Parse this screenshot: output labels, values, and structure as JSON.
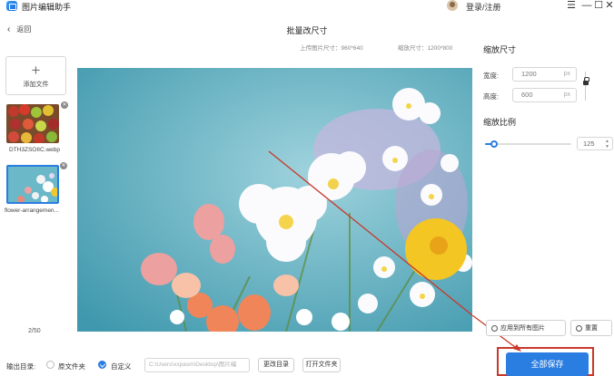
{
  "app": {
    "title": "图片编辑助手",
    "login": "登录/注册"
  },
  "window_controls": [
    "☰",
    "—",
    "☐",
    "✕"
  ],
  "nav": {
    "back": "返回",
    "page_title": "批量改尺寸"
  },
  "info": {
    "upload_size_label": "上传图片尺寸：960*640",
    "scaled_size_label": "缩放尺寸：1200*800"
  },
  "sidebar": {
    "add_file": "添加文件",
    "files": [
      {
        "name": "DTH3ZSOIIC.webp",
        "selected": false
      },
      {
        "name": "flower-arrangemen...",
        "selected": true
      }
    ],
    "page_count": "2/50"
  },
  "resize": {
    "title": "缩放尺寸",
    "width_label": "宽度:",
    "width_value": "1200",
    "height_label": "高度:",
    "height_value": "600",
    "unit": "px"
  },
  "scale": {
    "title": "缩放比例",
    "value": "125",
    "slider_fraction": 0.1
  },
  "actions": {
    "apply_all": "应用到所有图片",
    "reset": "重置"
  },
  "output": {
    "label": "输出目录:",
    "option_original": "原文件夹",
    "option_custom": "自定义",
    "selected": "custom",
    "path": "C:\\Users\\xxpasm\\Desktop\\图片编",
    "change_dir": "更改目录",
    "open_folder": "打开文件夹",
    "save_all": "全部保存"
  },
  "colors": {
    "accent": "#2a7de1",
    "highlight": "#c8392b",
    "annotation_arrow": "#c8392b"
  }
}
